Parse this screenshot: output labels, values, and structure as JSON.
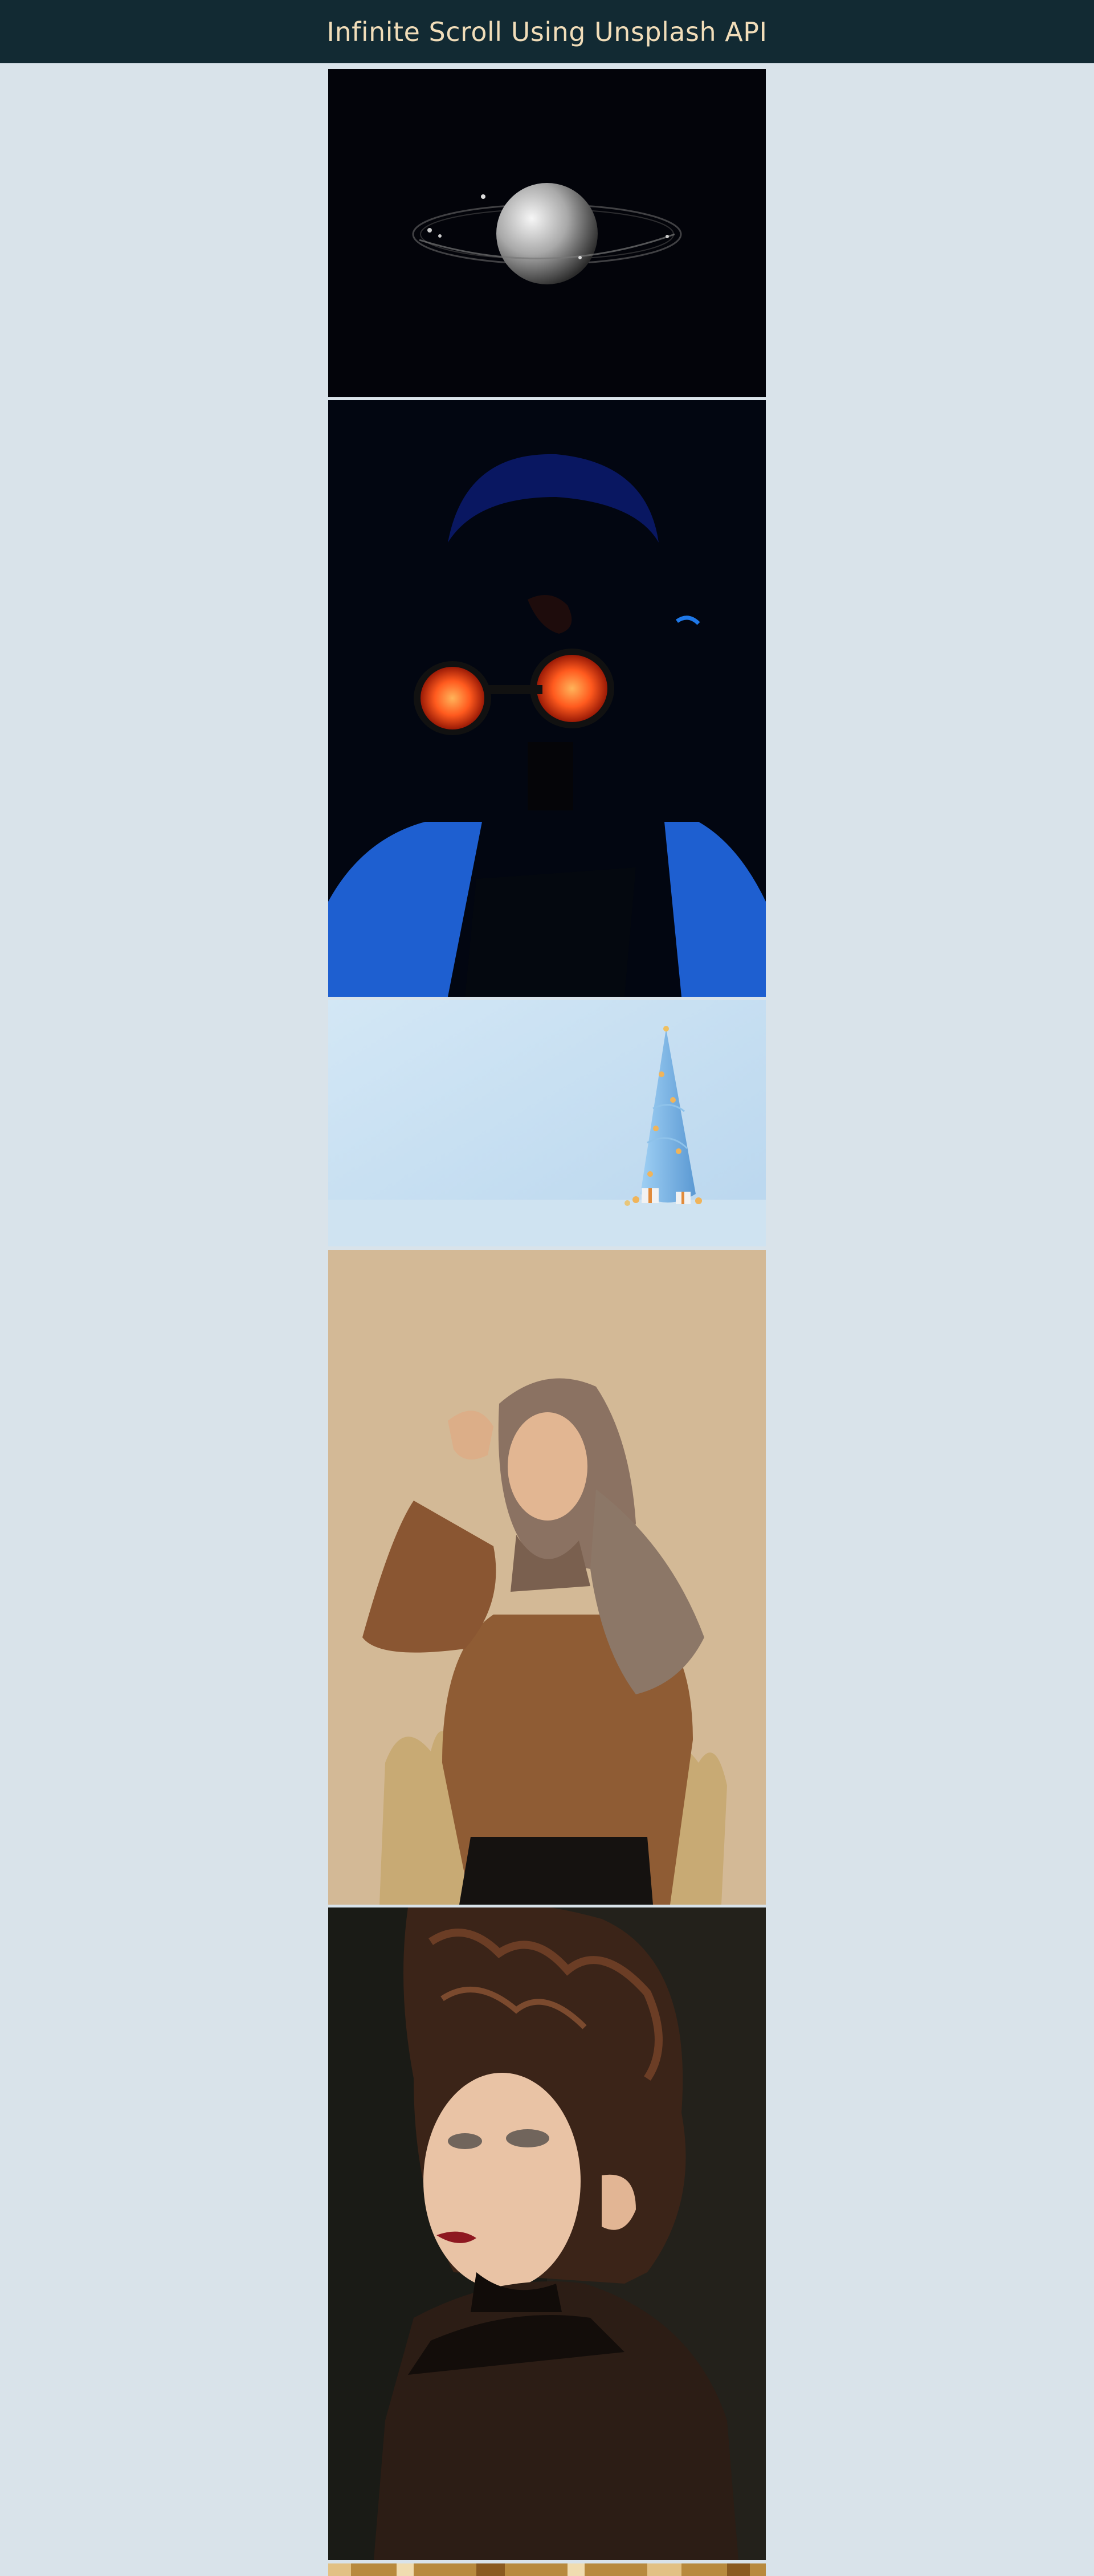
{
  "header": {
    "title": "Infinite Scroll Using Unsplash API"
  },
  "gallery": {
    "photos": [
      {
        "name": "photo-planet-with-rings",
        "subject": "Silver planet with rings on black background"
      },
      {
        "name": "photo-man-glowing-goggles",
        "subject": "Man wearing glowing orange goggles in blue light"
      },
      {
        "name": "photo-blue-christmas-tree",
        "subject": "Blue spiral Christmas tree with gifts"
      },
      {
        "name": "photo-woman-headscarf",
        "subject": "Woman in brown headscarf and ribbed top"
      },
      {
        "name": "photo-woman-curly-hair",
        "subject": "Woman with curly hair and red lips"
      },
      {
        "name": "photo-partial-next",
        "subject": "Next photo loading at bottom edge"
      }
    ]
  },
  "colors": {
    "page_background": "#d9e3ea",
    "header_background": "#122a33",
    "title_color": "#f1ddb9"
  }
}
